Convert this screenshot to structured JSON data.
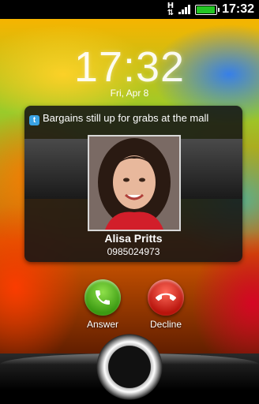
{
  "status_bar": {
    "data_icon": "H",
    "signal_bars": 4,
    "battery_level": 0.95,
    "time": "17:32"
  },
  "lockscreen": {
    "clock": "17:32",
    "date": "Fri, Apr 8"
  },
  "notification": {
    "icon": "twitter-icon",
    "text": "Bargains still up for grabs at the mall"
  },
  "caller": {
    "name": "Alisa Pritts",
    "number": "0985024973"
  },
  "actions": {
    "answer_label": "Answer",
    "decline_label": "Decline"
  },
  "colors": {
    "answer": "#3b9a12",
    "decline": "#b8140c",
    "twitter": "#3aa3e3"
  }
}
